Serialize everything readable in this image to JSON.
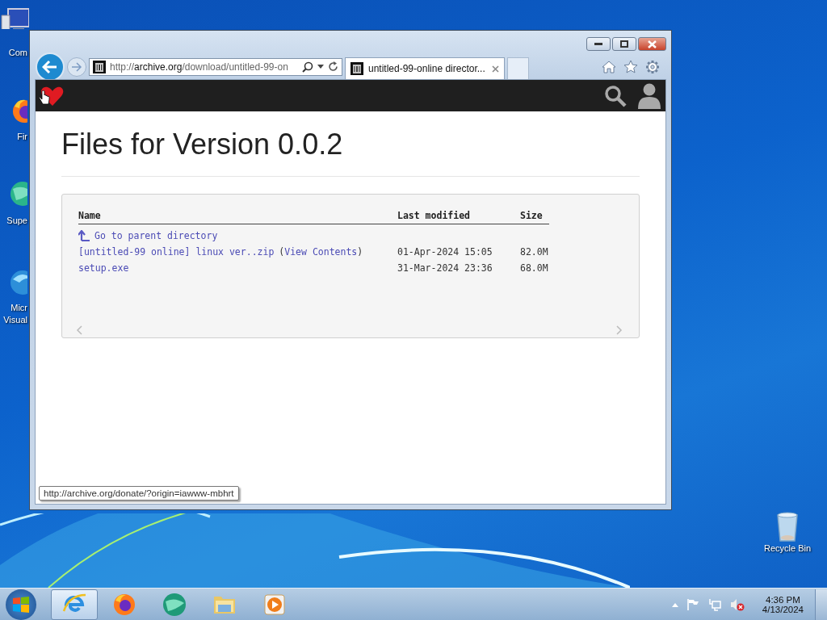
{
  "desktop": {
    "icons": [
      {
        "kind": "computer",
        "lines": [
          "Com"
        ]
      },
      {
        "kind": "firefox",
        "lines": [
          "Fir"
        ]
      },
      {
        "kind": "globe",
        "lines": [
          "Supe"
        ]
      },
      {
        "kind": "edge",
        "lines": [
          "Micr",
          "Visual"
        ]
      },
      {
        "kind": "recycle",
        "lines": [
          "Recycle Bin"
        ]
      }
    ]
  },
  "browser": {
    "address": {
      "scheme": "http://",
      "host": "archive.org",
      "path": "/download/untitled-99-on"
    },
    "tabs": [
      {
        "title": "untitled-99-online director...",
        "selected": true
      }
    ],
    "page": {
      "heading": "Files for Version 0.0.2",
      "columns": [
        "Name",
        "Last modified",
        "Size"
      ],
      "rows": [
        {
          "kind": "parent",
          "name": "Go to parent directory"
        },
        {
          "kind": "file",
          "name": "[untitled-99 online] linux ver..zip",
          "open": "(",
          "extra_link": "View Contents",
          "close": ")",
          "modified": "01-Apr-2024 15:05",
          "size": "82.0M"
        },
        {
          "kind": "file",
          "name": "setup.exe",
          "modified": "31-Mar-2024 23:36",
          "size": "68.0M"
        }
      ]
    },
    "status_tooltip": "http://archive.org/donate/?origin=iawww-mbhrt"
  },
  "taskbar": {
    "apps": [
      {
        "kind": "ie",
        "active": true
      },
      {
        "kind": "firefox",
        "active": false
      },
      {
        "kind": "globe",
        "active": false
      },
      {
        "kind": "folder",
        "active": false
      },
      {
        "kind": "media",
        "active": false
      }
    ],
    "clock": {
      "time": "4:36 PM",
      "date": "4/13/2024"
    }
  }
}
